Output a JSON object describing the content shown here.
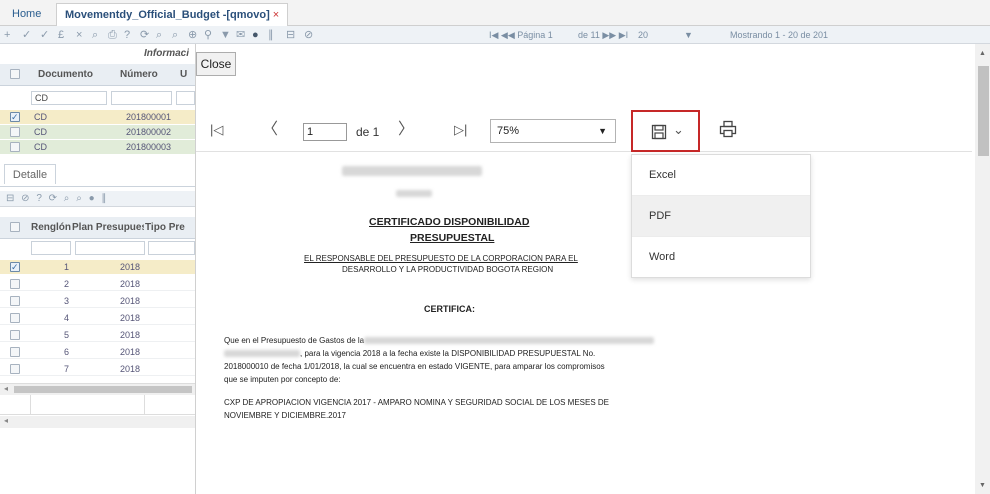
{
  "tabs": {
    "home": "Home",
    "active": "Movementdy_Official_Budget -[qmovo]",
    "close": "×"
  },
  "toolbar_icons": [
    "+",
    "✓",
    "✓",
    "£",
    "×",
    "⌕",
    "⎙",
    "?",
    "⟳",
    "⌕",
    "⌕",
    "⊕",
    "⚲",
    "▼",
    "✉",
    "●",
    "∥",
    "⊟",
    "⊘"
  ],
  "pager": {
    "nav_first_prev": "I◀ ◀◀ Página 1",
    "of": "de 11 ▶▶ ▶I",
    "size": "20",
    "size_arrow": "▼",
    "status": "Mostrando 1 - 20 de 201"
  },
  "left": {
    "info_header": "Informaci",
    "columns": [
      "Documento",
      "Número",
      "U"
    ],
    "filter": "CD",
    "rows": [
      {
        "doc": "CD",
        "num": "201800001",
        "checked": true,
        "style": "sel"
      },
      {
        "doc": "CD",
        "num": "201800002",
        "checked": false,
        "style": "alt"
      },
      {
        "doc": "CD",
        "num": "201800003",
        "checked": false,
        "style": "alt"
      }
    ],
    "detail_tab": "Detalle",
    "detail_icons": "⊟ ⊘ ? ⟳ ⌕ ⌕ ● ∥",
    "detail_columns": [
      "Renglón",
      "Plan Presupuest",
      "Tipo Pre"
    ],
    "detail_rows": [
      {
        "n": "1",
        "year": "2018",
        "checked": true
      },
      {
        "n": "2",
        "year": "2018",
        "checked": false
      },
      {
        "n": "3",
        "year": "2018",
        "checked": false
      },
      {
        "n": "4",
        "year": "2018",
        "checked": false
      },
      {
        "n": "5",
        "year": "2018",
        "checked": false
      },
      {
        "n": "6",
        "year": "2018",
        "checked": false
      },
      {
        "n": "7",
        "year": "2018",
        "checked": false
      }
    ],
    "scroll_left": "◂",
    "scroll_left2": "◂"
  },
  "viewer": {
    "close": "Close",
    "first": "|◁",
    "prev": "〈",
    "page": "1",
    "page_of": "de 1",
    "next": "〉",
    "last": "▷|",
    "zoom": "75%",
    "zoom_arrow": "▼",
    "save_icon": "💾",
    "save_caret": "⌄",
    "print_icon": "⎙",
    "export_options": [
      "Excel",
      "PDF",
      "Word"
    ]
  },
  "document": {
    "title1": "CERTIFICADO DISPONIBILIDAD",
    "title2": "PRESUPUESTAL",
    "resp1": "EL RESPONSABLE DEL PRESUPUESTO DE LA  CORPORACION PARA EL",
    "resp2": "DESARROLLO Y LA PRODUCTIVIDAD BOGOTA REGION",
    "certifica": "CERTIFICA:",
    "p1": "Que en el Presupuesto de Gastos de la",
    "p2": ", para la vigencia 2018 a la fecha existe la DISPONIBILIDAD PRESUPUESTAL No.",
    "p3": "2018000010 de fecha 1/01/2018, la cual se encuentra en estado VIGENTE, para amparar los compromisos",
    "p4": "que se imputen por concepto de:",
    "p5": "CXP DE APROPIACION VIGENCIA 2017 - AMPARO NOMINA Y SEGURIDAD SOCIAL DE LOS MESES DE",
    "p6": "NOVIEMBRE Y DICIEMBRE.2017"
  },
  "scroll": {
    "up": "▲",
    "down": "▼"
  }
}
